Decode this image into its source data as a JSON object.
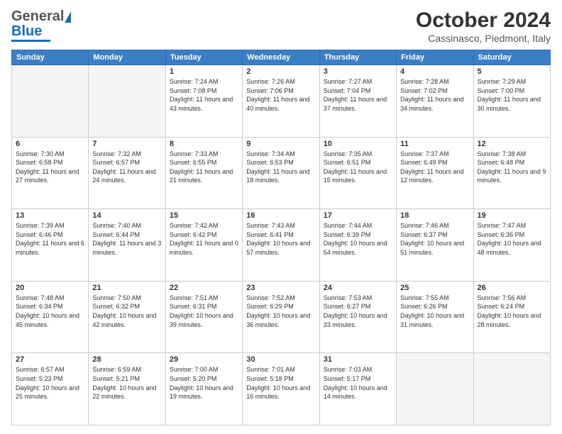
{
  "header": {
    "logo_general": "General",
    "logo_blue": "Blue",
    "title": "October 2024",
    "location": "Cassinasco, Piedmont, Italy"
  },
  "days_of_week": [
    "Sunday",
    "Monday",
    "Tuesday",
    "Wednesday",
    "Thursday",
    "Friday",
    "Saturday"
  ],
  "weeks": [
    [
      {
        "day": "",
        "sunrise": "",
        "sunset": "",
        "daylight": "",
        "empty": true
      },
      {
        "day": "",
        "sunrise": "",
        "sunset": "",
        "daylight": "",
        "empty": true
      },
      {
        "day": "1",
        "sunrise": "Sunrise: 7:24 AM",
        "sunset": "Sunset: 7:08 PM",
        "daylight": "Daylight: 11 hours and 43 minutes.",
        "empty": false
      },
      {
        "day": "2",
        "sunrise": "Sunrise: 7:26 AM",
        "sunset": "Sunset: 7:06 PM",
        "daylight": "Daylight: 11 hours and 40 minutes.",
        "empty": false
      },
      {
        "day": "3",
        "sunrise": "Sunrise: 7:27 AM",
        "sunset": "Sunset: 7:04 PM",
        "daylight": "Daylight: 11 hours and 37 minutes.",
        "empty": false
      },
      {
        "day": "4",
        "sunrise": "Sunrise: 7:28 AM",
        "sunset": "Sunset: 7:02 PM",
        "daylight": "Daylight: 11 hours and 34 minutes.",
        "empty": false
      },
      {
        "day": "5",
        "sunrise": "Sunrise: 7:29 AM",
        "sunset": "Sunset: 7:00 PM",
        "daylight": "Daylight: 11 hours and 30 minutes.",
        "empty": false
      }
    ],
    [
      {
        "day": "6",
        "sunrise": "Sunrise: 7:30 AM",
        "sunset": "Sunset: 6:58 PM",
        "daylight": "Daylight: 11 hours and 27 minutes.",
        "empty": false
      },
      {
        "day": "7",
        "sunrise": "Sunrise: 7:32 AM",
        "sunset": "Sunset: 6:57 PM",
        "daylight": "Daylight: 11 hours and 24 minutes.",
        "empty": false
      },
      {
        "day": "8",
        "sunrise": "Sunrise: 7:33 AM",
        "sunset": "Sunset: 6:55 PM",
        "daylight": "Daylight: 11 hours and 21 minutes.",
        "empty": false
      },
      {
        "day": "9",
        "sunrise": "Sunrise: 7:34 AM",
        "sunset": "Sunset: 6:53 PM",
        "daylight": "Daylight: 11 hours and 18 minutes.",
        "empty": false
      },
      {
        "day": "10",
        "sunrise": "Sunrise: 7:35 AM",
        "sunset": "Sunset: 6:51 PM",
        "daylight": "Daylight: 11 hours and 15 minutes.",
        "empty": false
      },
      {
        "day": "11",
        "sunrise": "Sunrise: 7:37 AM",
        "sunset": "Sunset: 6:49 PM",
        "daylight": "Daylight: 11 hours and 12 minutes.",
        "empty": false
      },
      {
        "day": "12",
        "sunrise": "Sunrise: 7:38 AM",
        "sunset": "Sunset: 6:48 PM",
        "daylight": "Daylight: 11 hours and 9 minutes.",
        "empty": false
      }
    ],
    [
      {
        "day": "13",
        "sunrise": "Sunrise: 7:39 AM",
        "sunset": "Sunset: 6:46 PM",
        "daylight": "Daylight: 11 hours and 6 minutes.",
        "empty": false
      },
      {
        "day": "14",
        "sunrise": "Sunrise: 7:40 AM",
        "sunset": "Sunset: 6:44 PM",
        "daylight": "Daylight: 11 hours and 3 minutes.",
        "empty": false
      },
      {
        "day": "15",
        "sunrise": "Sunrise: 7:42 AM",
        "sunset": "Sunset: 6:42 PM",
        "daylight": "Daylight: 11 hours and 0 minutes.",
        "empty": false
      },
      {
        "day": "16",
        "sunrise": "Sunrise: 7:43 AM",
        "sunset": "Sunset: 6:41 PM",
        "daylight": "Daylight: 10 hours and 57 minutes.",
        "empty": false
      },
      {
        "day": "17",
        "sunrise": "Sunrise: 7:44 AM",
        "sunset": "Sunset: 6:39 PM",
        "daylight": "Daylight: 10 hours and 54 minutes.",
        "empty": false
      },
      {
        "day": "18",
        "sunrise": "Sunrise: 7:46 AM",
        "sunset": "Sunset: 6:37 PM",
        "daylight": "Daylight: 10 hours and 51 minutes.",
        "empty": false
      },
      {
        "day": "19",
        "sunrise": "Sunrise: 7:47 AM",
        "sunset": "Sunset: 6:36 PM",
        "daylight": "Daylight: 10 hours and 48 minutes.",
        "empty": false
      }
    ],
    [
      {
        "day": "20",
        "sunrise": "Sunrise: 7:48 AM",
        "sunset": "Sunset: 6:34 PM",
        "daylight": "Daylight: 10 hours and 45 minutes.",
        "empty": false
      },
      {
        "day": "21",
        "sunrise": "Sunrise: 7:50 AM",
        "sunset": "Sunset: 6:32 PM",
        "daylight": "Daylight: 10 hours and 42 minutes.",
        "empty": false
      },
      {
        "day": "22",
        "sunrise": "Sunrise: 7:51 AM",
        "sunset": "Sunset: 6:31 PM",
        "daylight": "Daylight: 10 hours and 39 minutes.",
        "empty": false
      },
      {
        "day": "23",
        "sunrise": "Sunrise: 7:52 AM",
        "sunset": "Sunset: 6:29 PM",
        "daylight": "Daylight: 10 hours and 36 minutes.",
        "empty": false
      },
      {
        "day": "24",
        "sunrise": "Sunrise: 7:53 AM",
        "sunset": "Sunset: 6:27 PM",
        "daylight": "Daylight: 10 hours and 33 minutes.",
        "empty": false
      },
      {
        "day": "25",
        "sunrise": "Sunrise: 7:55 AM",
        "sunset": "Sunset: 6:26 PM",
        "daylight": "Daylight: 10 hours and 31 minutes.",
        "empty": false
      },
      {
        "day": "26",
        "sunrise": "Sunrise: 7:56 AM",
        "sunset": "Sunset: 6:24 PM",
        "daylight": "Daylight: 10 hours and 28 minutes.",
        "empty": false
      }
    ],
    [
      {
        "day": "27",
        "sunrise": "Sunrise: 6:57 AM",
        "sunset": "Sunset: 5:23 PM",
        "daylight": "Daylight: 10 hours and 25 minutes.",
        "empty": false
      },
      {
        "day": "28",
        "sunrise": "Sunrise: 6:59 AM",
        "sunset": "Sunset: 5:21 PM",
        "daylight": "Daylight: 10 hours and 22 minutes.",
        "empty": false
      },
      {
        "day": "29",
        "sunrise": "Sunrise: 7:00 AM",
        "sunset": "Sunset: 5:20 PM",
        "daylight": "Daylight: 10 hours and 19 minutes.",
        "empty": false
      },
      {
        "day": "30",
        "sunrise": "Sunrise: 7:01 AM",
        "sunset": "Sunset: 5:18 PM",
        "daylight": "Daylight: 10 hours and 16 minutes.",
        "empty": false
      },
      {
        "day": "31",
        "sunrise": "Sunrise: 7:03 AM",
        "sunset": "Sunset: 5:17 PM",
        "daylight": "Daylight: 10 hours and 14 minutes.",
        "empty": false
      },
      {
        "day": "",
        "sunrise": "",
        "sunset": "",
        "daylight": "",
        "empty": true
      },
      {
        "day": "",
        "sunrise": "",
        "sunset": "",
        "daylight": "",
        "empty": true
      }
    ]
  ]
}
